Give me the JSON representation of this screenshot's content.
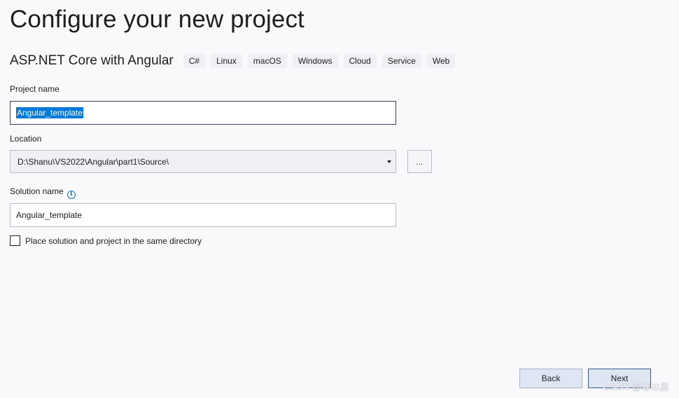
{
  "page": {
    "title": "Configure your new project"
  },
  "template": {
    "name": "ASP.NET Core with Angular",
    "tags": [
      "C#",
      "Linux",
      "macOS",
      "Windows",
      "Cloud",
      "Service",
      "Web"
    ]
  },
  "project_name": {
    "label": "Project name",
    "value": "Angular_template"
  },
  "location": {
    "label": "Location",
    "value": "D:\\Shanu\\VS2022\\Angular\\part1\\Source\\",
    "browse_label": "..."
  },
  "solution_name": {
    "label": "Solution name",
    "info_icon": "i",
    "value": "Angular_template"
  },
  "same_directory": {
    "label": "Place solution and project in the same directory",
    "checked": false
  },
  "buttons": {
    "back": "Back",
    "next": "Next"
  },
  "watermark": "CSDN @寒冰屋",
  "colors": {
    "background": "#f9f9fc",
    "selection": "#0078d7",
    "info": "#1b6fb6",
    "button_bg": "#dfe6f3"
  }
}
